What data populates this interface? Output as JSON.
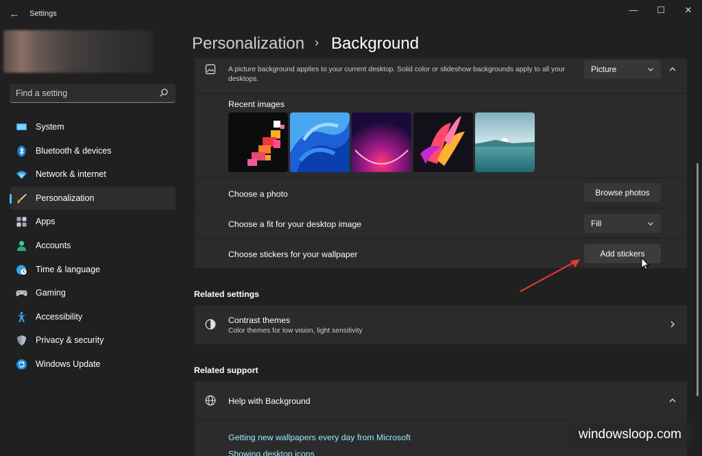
{
  "window": {
    "title": "Settings",
    "back_glyph": "←",
    "minimize_glyph": "—",
    "maximize_glyph": "☐",
    "close_glyph": "✕"
  },
  "search": {
    "placeholder": "Find a setting"
  },
  "sidebar": {
    "items": [
      {
        "label": "System",
        "icon": "system-display-icon"
      },
      {
        "label": "Bluetooth & devices",
        "icon": "bluetooth-icon"
      },
      {
        "label": "Network & internet",
        "icon": "wifi-icon"
      },
      {
        "label": "Personalization",
        "icon": "paintbrush-icon",
        "active": true
      },
      {
        "label": "Apps",
        "icon": "apps-grid-icon"
      },
      {
        "label": "Accounts",
        "icon": "person-icon"
      },
      {
        "label": "Time & language",
        "icon": "globe-clock-icon"
      },
      {
        "label": "Gaming",
        "icon": "gamepad-icon"
      },
      {
        "label": "Accessibility",
        "icon": "accessibility-icon"
      },
      {
        "label": "Privacy & security",
        "icon": "shield-icon"
      },
      {
        "label": "Windows Update",
        "icon": "update-icon"
      }
    ]
  },
  "breadcrumb": {
    "parent": "Personalization",
    "separator": "›",
    "current": "Background"
  },
  "background_card": {
    "description": "A picture background applies to your current desktop. Solid color or slideshow backgrounds apply to all your desktops.",
    "type_value": "Picture",
    "recent_images_label": "Recent images",
    "choose_photo_label": "Choose a photo",
    "browse_button": "Browse photos",
    "fit_label": "Choose a fit for your desktop image",
    "fit_value": "Fill",
    "stickers_label": "Choose stickers for your wallpaper",
    "stickers_button": "Add stickers"
  },
  "related_settings": {
    "title": "Related settings",
    "contrast_title": "Contrast themes",
    "contrast_sub": "Color themes for low vision, light sensitivity"
  },
  "related_support": {
    "title": "Related support",
    "help_title": "Help with Background",
    "links": [
      "Getting new wallpapers every day from Microsoft",
      "Showing desktop icons"
    ]
  },
  "watermark": "windowsloop.com",
  "colors": {
    "accent": "#4cc2ff",
    "link": "#99ebff",
    "annotation_arrow": "#e03a2f"
  }
}
